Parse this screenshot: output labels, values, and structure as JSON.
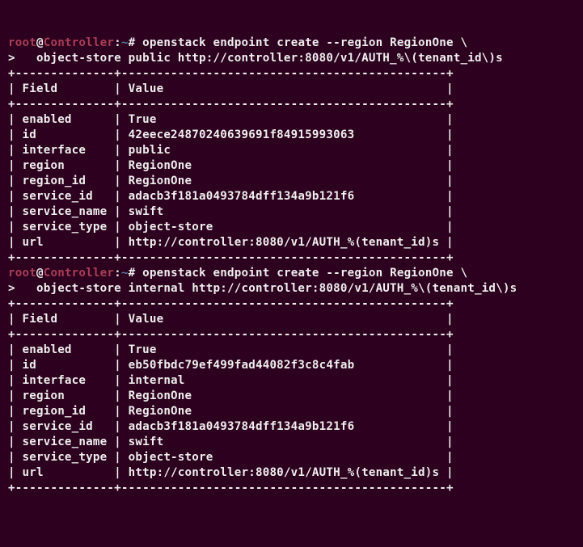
{
  "prompt": {
    "user": "root",
    "at": "@",
    "host": "Controller",
    "colon": ":",
    "path": "~",
    "hash": "# "
  },
  "cont": ">   ",
  "blocks": [
    {
      "cmd_line1": "openstack endpoint create --region RegionOne \\",
      "cmd_line2": "object-store public http://controller:8080/v1/AUTH_%\\(tenant_id\\)s",
      "rows": [
        [
          "enabled",
          "True"
        ],
        [
          "id",
          "42eece24870240639691f84915993063"
        ],
        [
          "interface",
          "public"
        ],
        [
          "region",
          "RegionOne"
        ],
        [
          "region_id",
          "RegionOne"
        ],
        [
          "service_id",
          "adacb3f181a0493784dff134a9b121f6"
        ],
        [
          "service_name",
          "swift"
        ],
        [
          "service_type",
          "object-store"
        ],
        [
          "url",
          "http://controller:8080/v1/AUTH_%(tenant_id)s"
        ]
      ]
    },
    {
      "cmd_line1": "openstack endpoint create --region RegionOne \\",
      "cmd_line2": "object-store internal http://controller:8080/v1/AUTH_%\\(tenant_id\\)s",
      "rows": [
        [
          "enabled",
          "True"
        ],
        [
          "id",
          "eb50fbdc79ef499fad44082f3c8c4fab"
        ],
        [
          "interface",
          "internal"
        ],
        [
          "region",
          "RegionOne"
        ],
        [
          "region_id",
          "RegionOne"
        ],
        [
          "service_id",
          "adacb3f181a0493784dff134a9b121f6"
        ],
        [
          "service_name",
          "swift"
        ],
        [
          "service_type",
          "object-store"
        ],
        [
          "url",
          "http://controller:8080/v1/AUTH_%(tenant_id)s"
        ]
      ]
    }
  ],
  "table": {
    "header_field": "Field",
    "header_value": "Value",
    "col1_width": 14,
    "col2_width": 46
  }
}
